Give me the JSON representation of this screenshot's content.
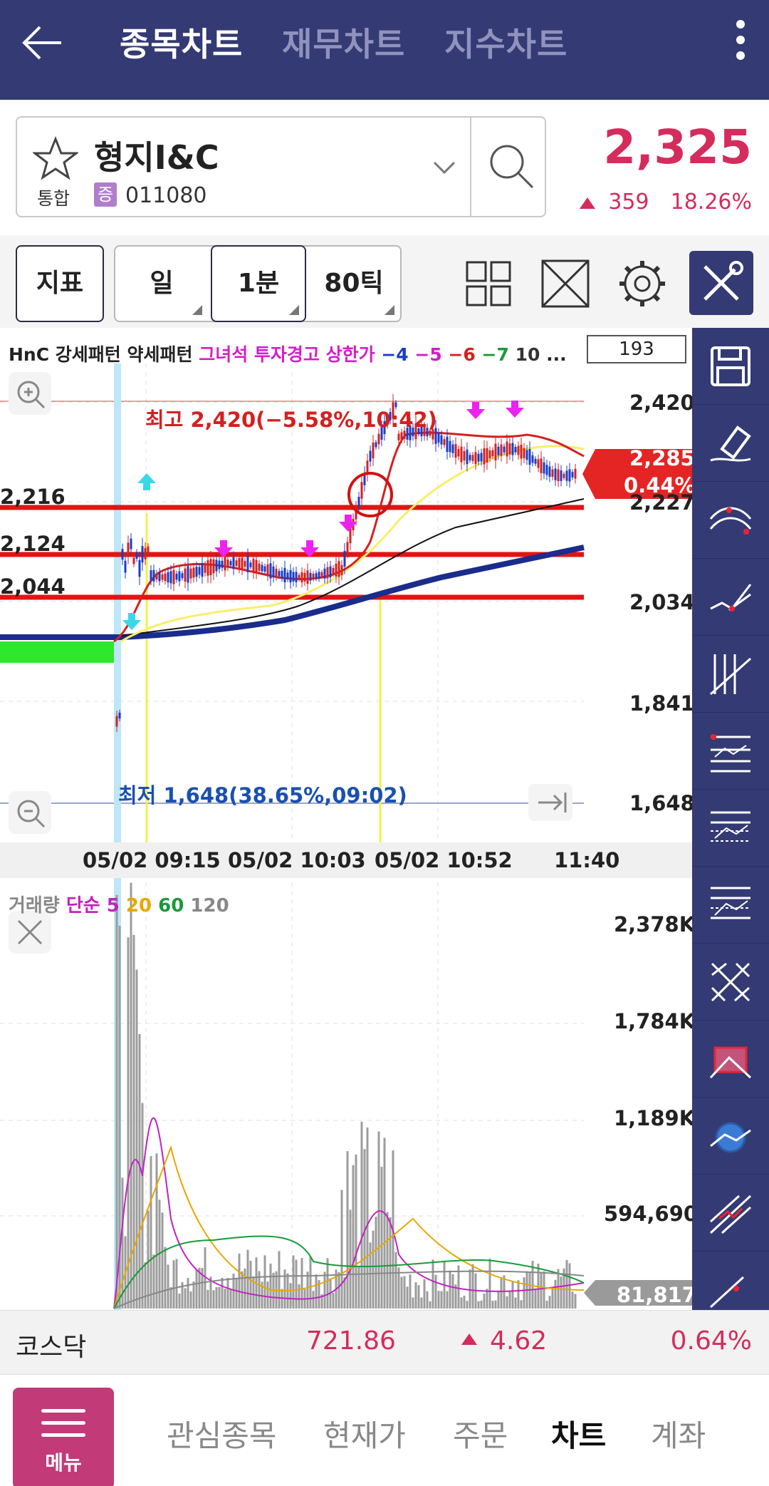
{
  "header": {
    "tabs": [
      {
        "label": "종목차트",
        "active": true
      },
      {
        "label": "재무차트",
        "active": false
      },
      {
        "label": "지수차트",
        "active": false
      }
    ],
    "bg_color": "#343a73"
  },
  "stock": {
    "name": "형지I&C",
    "market": "통합",
    "badge": "증",
    "code": "011080",
    "price": "2,325",
    "change": "359",
    "change_pct": "18.26%",
    "up_color": "#d42c5c"
  },
  "toolbar": {
    "indicator_btn": "지표",
    "periods": [
      {
        "label": "일",
        "selected": false
      },
      {
        "label": "1분",
        "selected": true
      },
      {
        "label": "80틱",
        "selected": false
      }
    ],
    "icons": [
      "grid-layout-icon",
      "fullscreen-icon",
      "settings-icon",
      "drawing-tools-icon"
    ]
  },
  "chart": {
    "indicator_text": {
      "black": "HnC 강세패턴 약세패턴",
      "magenta": "그녀석 투자경고 상한가",
      "nums": [
        "−4",
        "−5",
        "−6",
        "−7",
        "10",
        "..."
      ]
    },
    "count_box": "193",
    "high_note": "최고 2,420(−5.58%,10:42)",
    "low_note": "최저 1,648(38.65%,09:02)",
    "price_axis": [
      "2,420",
      "2,227",
      "2,034",
      "1,841",
      "1,648"
    ],
    "current_price_tag": "2,285",
    "current_pct_tag": "0.44%",
    "left_levels": [
      "2,216",
      "2,124",
      "2,044"
    ],
    "time_labels": [
      "05/02 09:15",
      "05/02 10:03",
      "05/02 10:52",
      "11:40"
    ],
    "volume_title": {
      "main": "거래량",
      "type": "단순",
      "p5": "5",
      "p20": "20",
      "p60": "60",
      "p120": "120"
    },
    "volume_axis": [
      "2,378K",
      "1,784K",
      "1,189K",
      "594,690"
    ],
    "volume_tag": "81,817"
  },
  "chart_data": {
    "type": "candlestick",
    "title": "",
    "price_range": [
      1648,
      2420
    ],
    "high": {
      "value": 2420,
      "pct": -5.58,
      "time": "10:42"
    },
    "low": {
      "value": 1648,
      "pct": 38.65,
      "time": "09:02"
    },
    "current": 2285,
    "horizontal_levels": [
      2216,
      2124,
      2044
    ],
    "volume_axis_ticks": [
      2378000,
      1784000,
      1189000,
      594690
    ],
    "last_volume": 81817
  },
  "right_tools": [
    "save-icon",
    "eraser-icon",
    "curve-tool-icon",
    "trendline-icon",
    "parallel-channel-icon",
    "fibonacci-icon",
    "gann-icon",
    "grid-lines-icon",
    "cross-lines-icon",
    "rectangle-icon",
    "ellipse-icon",
    "pitchfork-icon"
  ],
  "index_bar": {
    "name": "코스닥",
    "value": "721.86",
    "change": "4.62",
    "pct": "0.64%"
  },
  "bottom_nav": {
    "menu_label": "메뉴",
    "items": [
      {
        "label": "관심종목",
        "active": false
      },
      {
        "label": "현재가",
        "active": false
      },
      {
        "label": "주문",
        "active": false
      },
      {
        "label": "차트",
        "active": true
      },
      {
        "label": "계좌",
        "active": false
      }
    ]
  }
}
